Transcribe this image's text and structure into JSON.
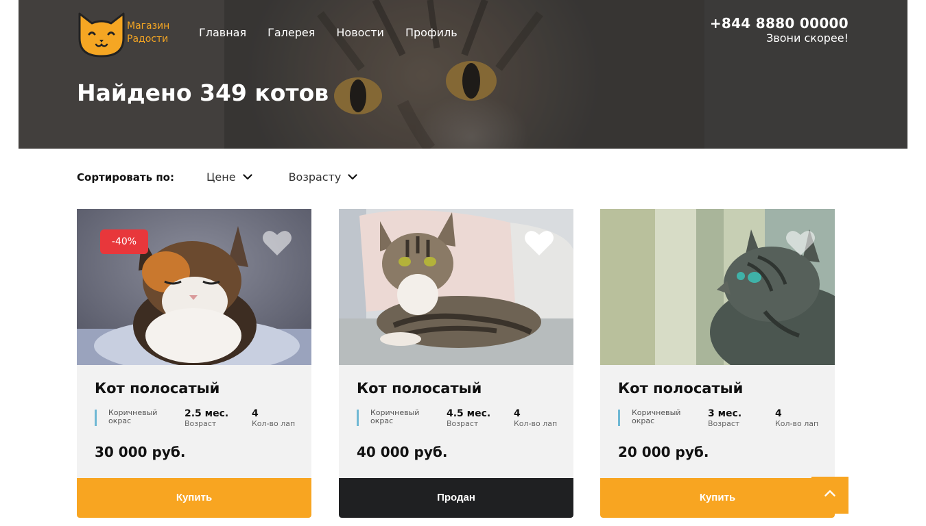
{
  "header": {
    "logo_text_line1": "Магазин",
    "logo_text_line2": "Радости",
    "nav": [
      "Главная",
      "Галерея",
      "Новости",
      "Профиль"
    ],
    "phone": "+844 8880 00000",
    "phone_caption": "Звони скорее!",
    "found_title": "Найдено 349 котов"
  },
  "sort": {
    "label": "Сортировать по:",
    "options": [
      "Цене",
      "Возрасту"
    ]
  },
  "cards": [
    {
      "discount": "-40%",
      "title": "Кот полосатый",
      "color": "Коричневый окрас",
      "age_value": "2.5 мес.",
      "age_label": "Возраст",
      "paws_value": "4",
      "paws_label": "Кол-во лап",
      "price": "30 000 руб.",
      "button": "Купить",
      "favorited": false
    },
    {
      "title": "Кот полосатый",
      "color": "Коричневый окрас",
      "age_value": "4.5 мес.",
      "age_label": "Возраст",
      "paws_value": "4",
      "paws_label": "Кол-во лап",
      "price": "40 000 руб.",
      "button": "Продан",
      "favorited": true
    },
    {
      "title": "Кот полосатый",
      "color": "Коричневый окрас",
      "age_value": "3 мес.",
      "age_label": "Возраст",
      "paws_value": "4",
      "paws_label": "Кол-во лап",
      "price": "20 000 руб.",
      "button": "Купить",
      "favorited": false
    }
  ],
  "icons": {
    "logo": "cat-face-logo-icon",
    "sort_chevron": "chevron-down-icon",
    "favorite": "heart-icon",
    "scroll_top": "chevron-up-icon"
  },
  "colors": {
    "accent": "#f8a521",
    "sold": "#1f2022",
    "discount": "#e8373b",
    "spec_bar": "#6fb8d4",
    "card_bg": "#f2f2f2"
  }
}
